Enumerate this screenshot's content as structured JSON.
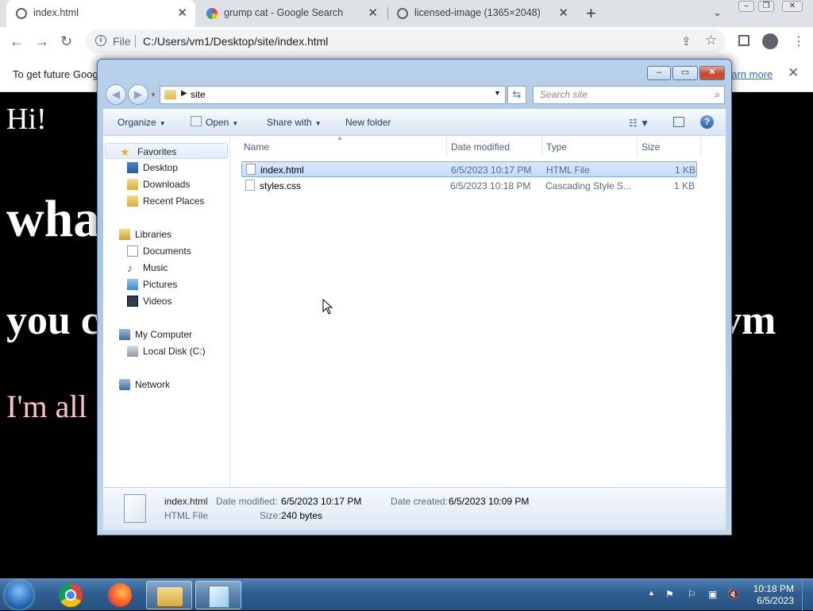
{
  "browser": {
    "tabs": [
      {
        "title": "index.html",
        "active": true
      },
      {
        "title": "grump cat - Google Search",
        "active": false
      },
      {
        "title": "licensed-image (1365×2048)",
        "active": false
      }
    ],
    "url_scheme_label": "File",
    "url": "C:/Users/vm1/Desktop/site/index.html",
    "infobar": {
      "text": "To get future Goog",
      "link": "earn more"
    }
  },
  "page": {
    "lines": [
      "Hi!",
      "wha",
      "you c",
      "vm",
      "I'm all"
    ]
  },
  "explorer": {
    "breadcrumb": "site",
    "search_placeholder": "Search site",
    "commands": {
      "organize": "Organize",
      "open": "Open",
      "share_with": "Share with",
      "new_folder": "New folder"
    },
    "nav": {
      "favorites": "Favorites",
      "desktop": "Desktop",
      "downloads": "Downloads",
      "recent_places": "Recent Places",
      "libraries": "Libraries",
      "documents": "Documents",
      "music": "Music",
      "pictures": "Pictures",
      "videos": "Videos",
      "my_computer": "My Computer",
      "local_disk": "Local Disk (C:)",
      "network": "Network"
    },
    "columns": {
      "name": "Name",
      "date": "Date modified",
      "type": "Type",
      "size": "Size"
    },
    "files": [
      {
        "name": "index.html",
        "date": "6/5/2023 10:17 PM",
        "type": "HTML File",
        "size": "1 KB",
        "selected": true
      },
      {
        "name": "styles.css",
        "date": "6/5/2023 10:18 PM",
        "type": "Cascading Style S...",
        "size": "1 KB",
        "selected": false
      }
    ],
    "details": {
      "filename": "index.html",
      "filetype": "HTML File",
      "modified_label": "Date modified:",
      "modified_value": "6/5/2023 10:17 PM",
      "created_label": "Date created:",
      "created_value": "6/5/2023 10:09 PM",
      "size_label": "Size:",
      "size_value": "240 bytes"
    }
  },
  "taskbar": {
    "time": "10:18 PM",
    "date": "6/5/2023"
  },
  "colors": {
    "page_bg": "#000000",
    "page_text": "#ffffff",
    "page_pink": "#ffc0cb",
    "selection": "#c2dcfc",
    "link": "#1a73e8"
  }
}
